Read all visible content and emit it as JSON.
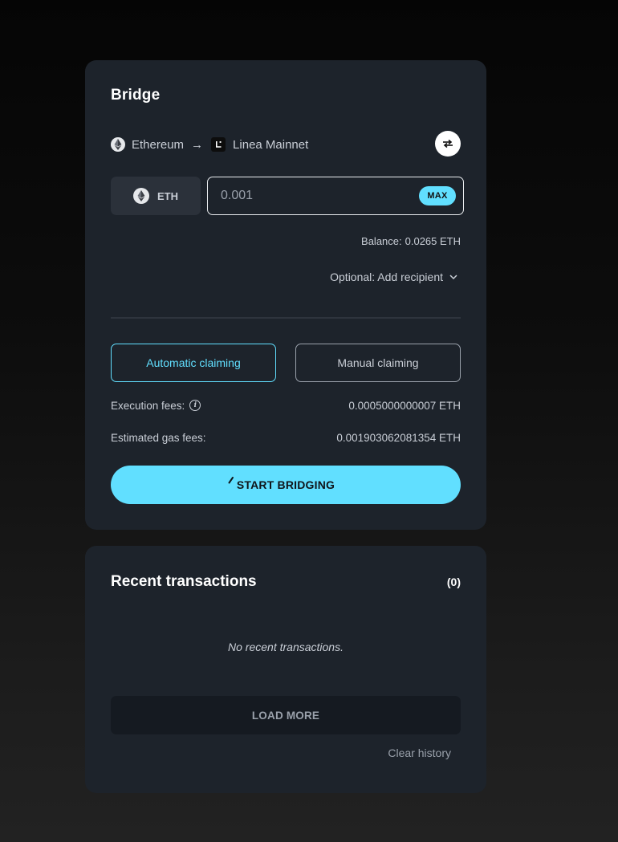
{
  "bridge": {
    "title": "Bridge",
    "from_chain": "Ethereum",
    "arrow": "→",
    "to_chain": "Linea Mainnet",
    "token_label": "ETH",
    "amount_value": "0.001",
    "max_label": "MAX",
    "balance_label": "Balance:",
    "balance_value": "0.0265 ETH",
    "recipient_label": "Optional: Add recipient",
    "claim_options": {
      "automatic": "Automatic claiming",
      "manual": "Manual claiming",
      "selected": "automatic"
    },
    "execution_fees_label": "Execution fees:",
    "execution_fees_value": "0.0005000000007 ETH",
    "gas_fees_label": "Estimated gas fees:",
    "gas_fees_value": "0.001903062081354 ETH",
    "start_label": "START BRIDGING"
  },
  "recent": {
    "title": "Recent transactions",
    "count": "(0)",
    "empty_text": "No recent transactions.",
    "load_more_label": "LOAD MORE",
    "clear_history_label": "Clear history"
  },
  "colors": {
    "accent": "#61dfff",
    "card": "#1d232b",
    "button_dark": "#2b313a"
  },
  "icons": {
    "from_chain": "ethereum-icon",
    "to_chain": "linea-icon",
    "swap": "swap-arrows-icon",
    "token": "ethereum-icon",
    "recipient": "chevron-down-icon",
    "execution_fees": "info-icon",
    "start": "spinner-icon"
  }
}
